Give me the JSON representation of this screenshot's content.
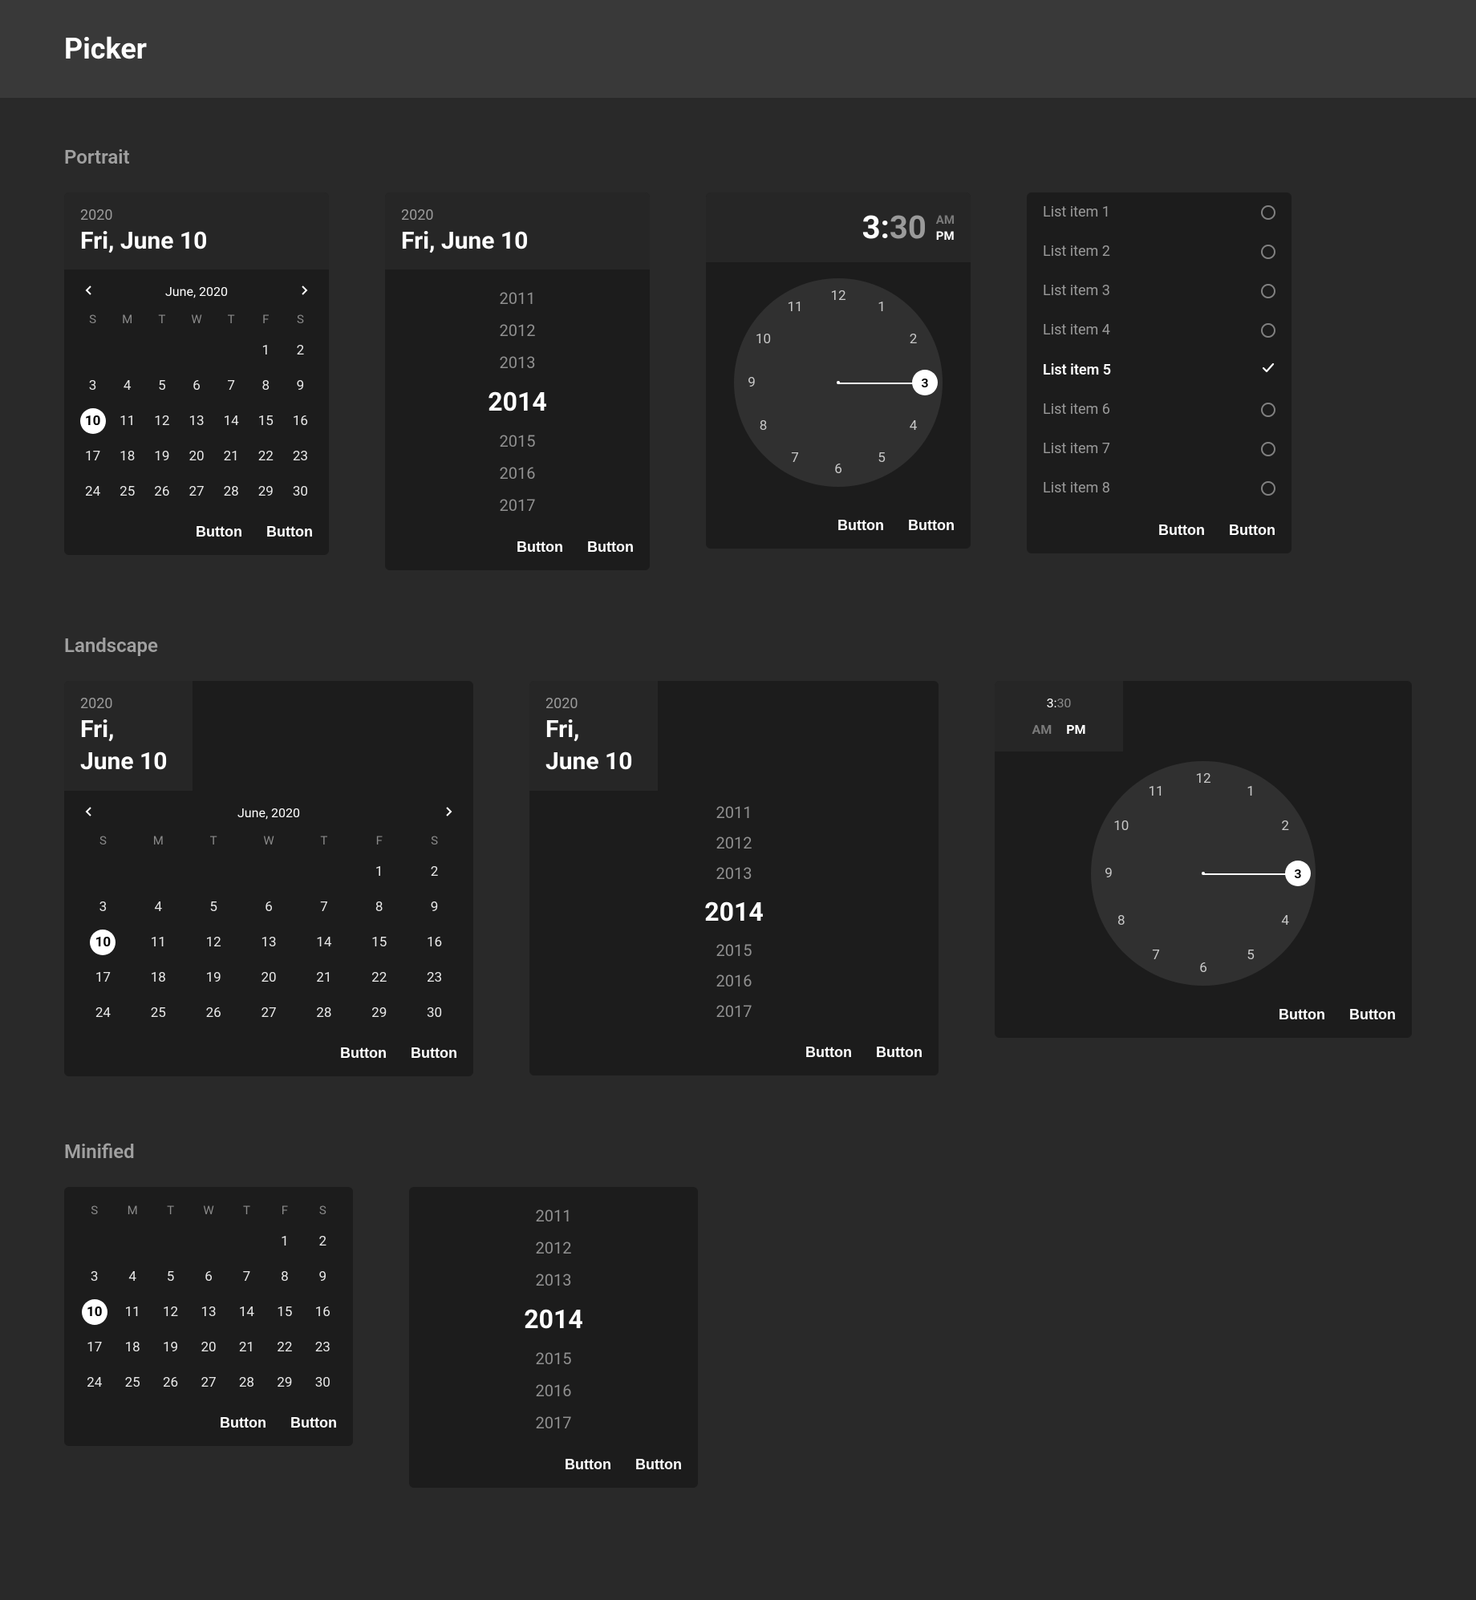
{
  "pageTitle": "Picker",
  "sections": {
    "portrait": "Portrait",
    "landscape": "Landscape",
    "minified": "Minified"
  },
  "date": {
    "year": "2020",
    "label": "Fri, June 10",
    "labelLine1": "Fri,",
    "labelLine2": "June 10"
  },
  "calendar": {
    "monthLabel": "June, 2020",
    "weekdays": [
      "S",
      "M",
      "T",
      "W",
      "T",
      "F",
      "S"
    ],
    "leading": 5,
    "days": 30,
    "selected": 10
  },
  "years": {
    "list": [
      "2011",
      "2012",
      "2013",
      "2014",
      "2015",
      "2016",
      "2017"
    ],
    "selected": "2014"
  },
  "time": {
    "hour": "3",
    "minute": "30",
    "colon": ":",
    "am": "AM",
    "pm": "PM",
    "selectedHour": 3
  },
  "clockNumbers": [
    "12",
    "1",
    "2",
    "3",
    "4",
    "5",
    "6",
    "7",
    "8",
    "9",
    "10",
    "11"
  ],
  "list": {
    "items": [
      "List item 1",
      "List item 2",
      "List item 3",
      "List item 4",
      "List item 5",
      "List item 6",
      "List item 7",
      "List item 8"
    ],
    "selectedIndex": 4
  },
  "buttons": {
    "primary": "Button",
    "secondary": "Button"
  }
}
